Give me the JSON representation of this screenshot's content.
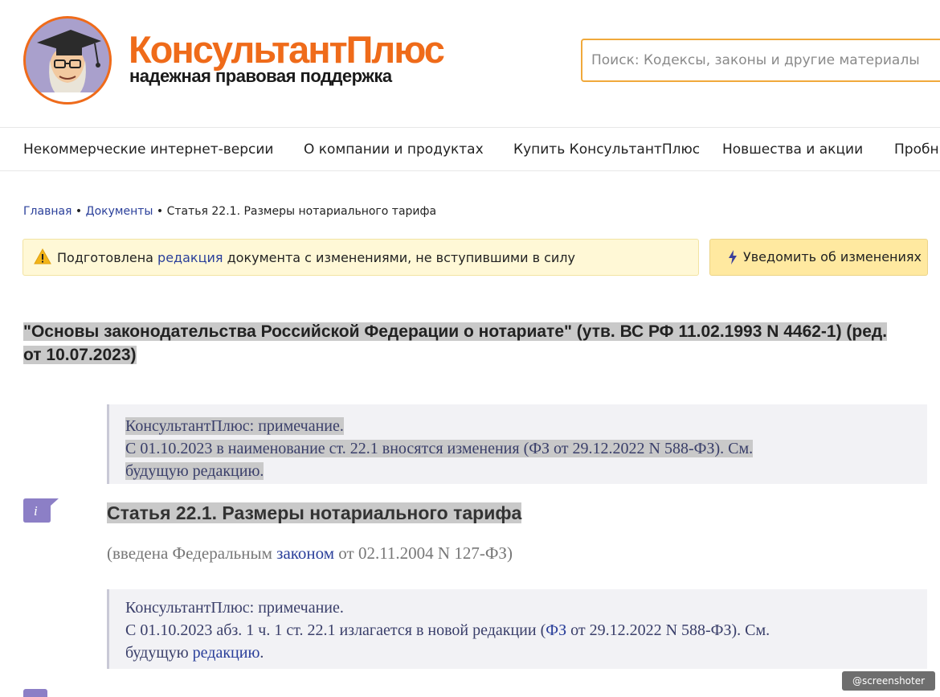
{
  "header": {
    "brand_name": "КонсультантПлюс",
    "brand_tagline": "надежная правовая поддержка",
    "search_placeholder": "Поиск: Кодексы, законы и другие материалы"
  },
  "nav": {
    "items": [
      "Некоммерческие интернет-версии",
      "О компании и продуктах",
      "Купить КонсультантПлюс",
      "Новшества и акции",
      "Пробн"
    ]
  },
  "breadcrumb": {
    "home": "Главная",
    "separator": " • ",
    "documents": "Документы",
    "current": "Статья 22.1. Размеры нотариального тарифа"
  },
  "notice": {
    "text_before": "Подготовлена ",
    "link": "редакция",
    "text_after": " документа с изменениями, не вступившими в силу",
    "button_label": "Уведомить об изменениях"
  },
  "document": {
    "title": "\"Основы законодательства Российской Федерации о нотариате\" (утв. ВС РФ 11.02.1993 N 4462-1) (ред. от 10.07.2023)",
    "note1": {
      "heading": "КонсультантПлюс: примечание.",
      "line1": "С 01.10.2023 в наименование ст. 22.1 вносятся изменения (ФЗ от 29.12.2022 N 588-ФЗ). См.",
      "line2": "будущую редакцию."
    },
    "article_title": "Статья 22.1. Размеры нотариального тарифа",
    "intro": {
      "before": "(введена Федеральным ",
      "link": "законом",
      "after": " от 02.11.2004 N 127-ФЗ)"
    },
    "note2": {
      "heading": "КонсультантПлюс: примечание.",
      "line1_before": "С 01.10.2023 абз. 1 ч. 1 ст. 22.1 излагается в новой редакции (",
      "line1_link": "ФЗ",
      "line1_after": " от 29.12.2022 N 588-ФЗ). См.",
      "line2_before": "будущую ",
      "line2_link": "редакцию",
      "line2_after": "."
    }
  },
  "watermark": "@screenshoter",
  "colors": {
    "brand_orange": "#ef6b1a",
    "link_blue": "#2a3f9a",
    "notice_bg": "#fff8d6",
    "button_bg": "#ffe9a0",
    "highlight_gray": "#c9c9c9",
    "icon_purple": "#8c7fc6"
  }
}
